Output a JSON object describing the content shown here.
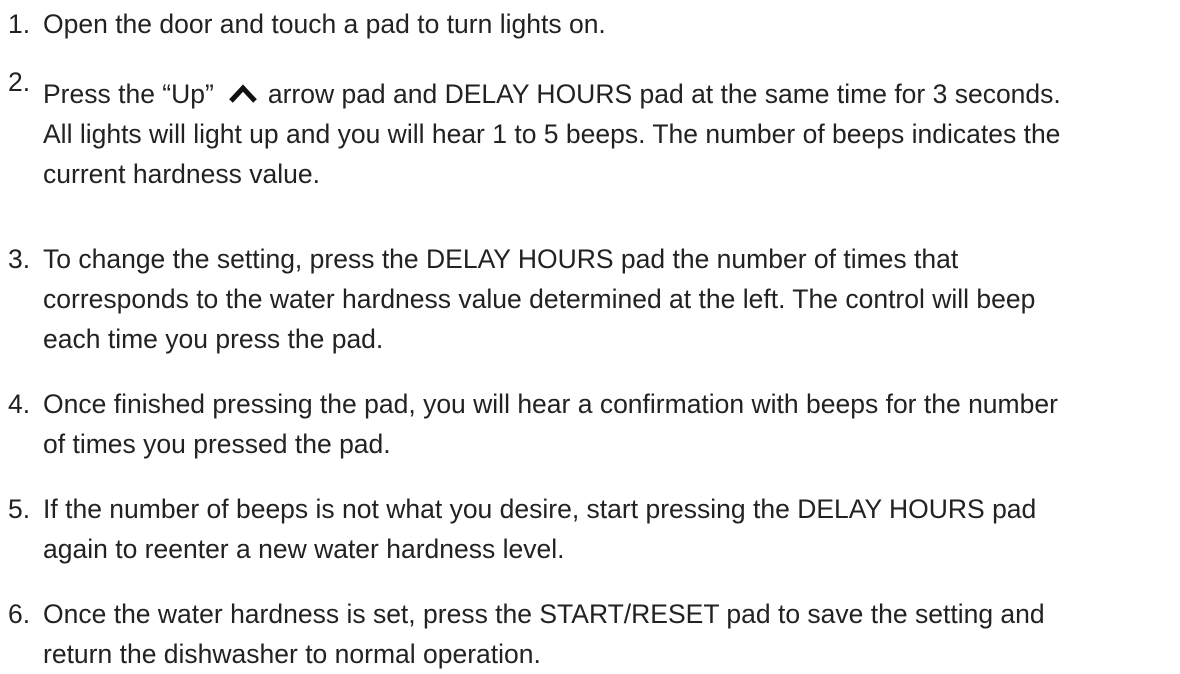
{
  "steps": [
    {
      "number": "1.",
      "lines": [
        "Open the door and touch a pad to turn lights on."
      ]
    },
    {
      "number": "2.",
      "line1_before_icon": "Press the “Up”",
      "icon": "up-arrow-icon",
      "line1_after_icon": "arrow pad and DELAY HOURS pad at the same time for 3 seconds.",
      "lines": [
        "All lights will light up and you will hear 1 to 5 beeps. The number of beeps indicates the",
        "current hardness value."
      ]
    },
    {
      "number": "3.",
      "lines": [
        "To change the setting, press the DELAY HOURS pad the number of times that",
        "corresponds to the water hardness value determined at the left. The control will beep",
        "each time you press the pad."
      ]
    },
    {
      "number": "4.",
      "lines": [
        "Once finished pressing the pad, you will hear a confirmation with beeps for the number",
        "of times you pressed the pad."
      ]
    },
    {
      "number": "5.",
      "lines": [
        "If the number of beeps is not what you desire, start pressing the DELAY HOURS pad",
        "again to reenter a new water hardness level."
      ]
    },
    {
      "number": "6.",
      "lines": [
        "Once the water hardness is set, press the START/RESET pad to save the setting and",
        "return the dishwasher to normal operation."
      ]
    }
  ]
}
